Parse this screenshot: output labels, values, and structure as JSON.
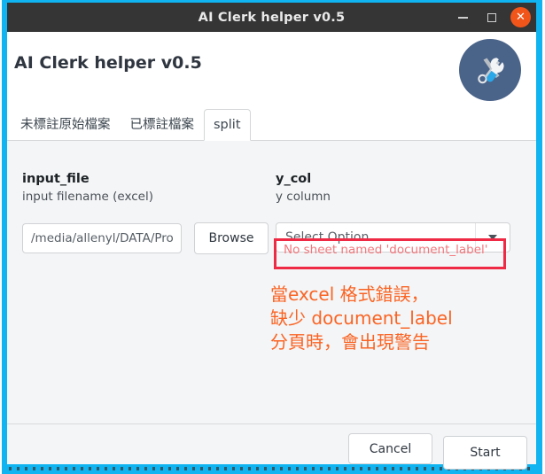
{
  "window": {
    "title": "AI Clerk helper v0.5",
    "controls": {
      "minimize": "minimize-icon",
      "maximize": "maximize-icon",
      "close": "✕"
    }
  },
  "header": {
    "app_name": "AI Clerk helper v0.5",
    "logo": "tools-icon"
  },
  "tabs": [
    {
      "label": "未標註原始檔案",
      "active": false
    },
    {
      "label": "已標註檔案",
      "active": false
    },
    {
      "label": "split",
      "active": true
    }
  ],
  "fields": {
    "input_file": {
      "label": "input_file",
      "help": "input filename (excel)",
      "value": "/media/allenyl/DATA/Pro",
      "placeholder": "input filename (excel)",
      "browse_label": "Browse"
    },
    "y_col": {
      "label": "y_col",
      "help": "y column",
      "selected": "Select Option",
      "options": [
        "Select Option"
      ],
      "error": "No sheet named 'document_label'"
    }
  },
  "annotation": {
    "lines": [
      "當excel 格式錯誤，",
      "缺少 document_label",
      "分頁時，會出現警告"
    ],
    "color": "#fa6424",
    "box_color": "#ef2a45"
  },
  "footer": {
    "cancel_label": "Cancel",
    "start_label": "Start"
  },
  "colors": {
    "titlebar_bg": "#353535",
    "panel_bg": "#f4f5f6",
    "selection_border": "#0fb4f0",
    "close_button": "#f2551a",
    "logo_bg": "#4a6389",
    "error_text": "#f4767b"
  }
}
